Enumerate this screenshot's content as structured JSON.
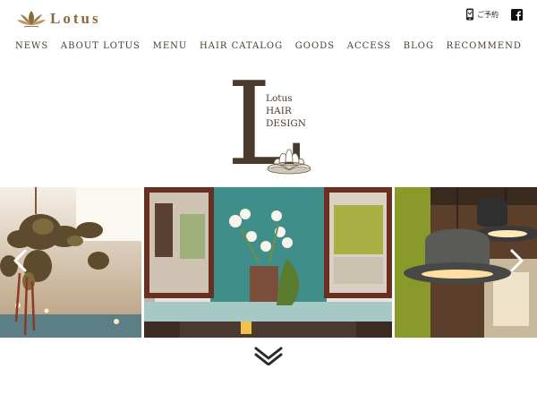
{
  "brand": {
    "name": "Lotus",
    "accent": "#8a6b3c",
    "text_color": "#4a3a2c"
  },
  "header": {
    "reserve_label": "ご予約",
    "reserve_icon": "phone-icon",
    "social_icon": "facebook-icon"
  },
  "nav": {
    "items": [
      "NEWS",
      "ABOUT LOTUS",
      "MENU",
      "HAIR CATALOG",
      "GOODS",
      "ACCESS",
      "BLOG",
      "RECOMMEND"
    ]
  },
  "hero": {
    "big_letter": "L",
    "lines": [
      "Lotus",
      "HAIR",
      "DESIGN"
    ]
  },
  "slider": {
    "slides": [
      "dried-flower-hanging-photo",
      "salon-interior-mirror-photo",
      "hat-pendant-lamp-photo"
    ],
    "prev_icon": "chevron-left-icon",
    "next_icon": "chevron-right-icon"
  },
  "scroll_icon": "double-chevron-down-icon"
}
